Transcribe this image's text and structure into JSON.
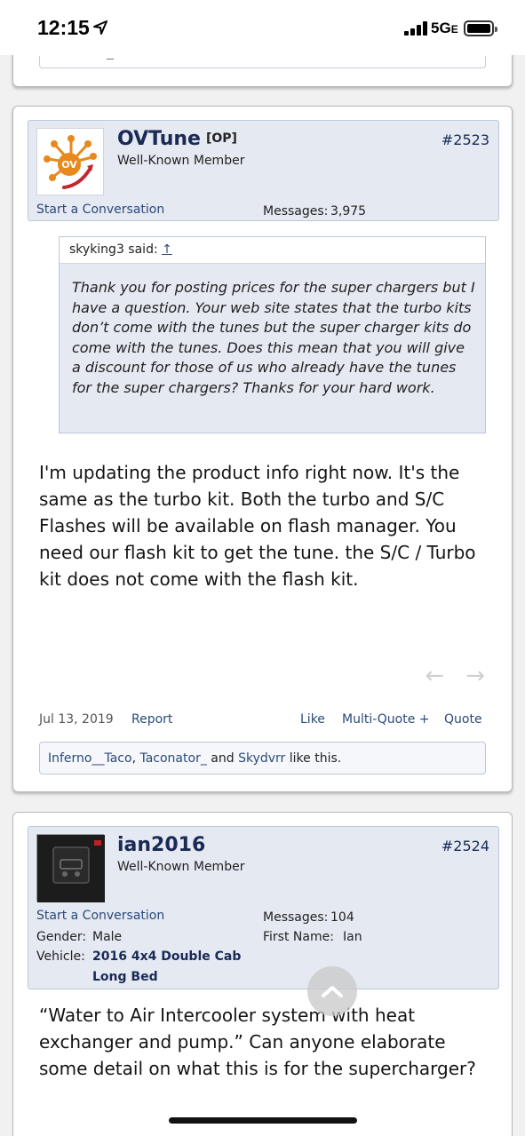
{
  "status_bar": {
    "time": "12:15",
    "network": "5G",
    "network_suffix": "E"
  },
  "posts": [
    {
      "username": "OVTune",
      "badge": "[OP]",
      "user_title": "Well-Known Member",
      "post_number": "#2523",
      "start_conversation": "Start a Conversation",
      "messages_label": "Messages:",
      "messages_value": "3,975",
      "quote": {
        "author": "skyking3 said:",
        "arrow": "↑",
        "text": "Thank you for posting prices for the super chargers but I have a question. Your web site states that the turbo kits don’t come with the tunes but the super charger kits do come with the tunes. Does this mean that you will give a discount for those of us who already have the tunes for the super chargers? Thanks for your hard work."
      },
      "message": "I'm updating the product info right now. It's the same as the turbo kit. Both the turbo and S/C Flashes will be available on flash manager. You need our flash kit to get the tune. the S/C / Turbo kit does not come with the flash kit.",
      "date": "Jul 13, 2019",
      "report": "Report",
      "like": "Like",
      "multi_quote": "Multi-Quote +",
      "quote_label": "Quote",
      "likes": {
        "user1": "Inferno__Taco",
        "sep1": ",",
        "user2": "Taconator_",
        "and": "and",
        "user3": "Skydvrr",
        "suffix": "like this."
      }
    },
    {
      "username": "ian2016",
      "user_title": "Well-Known Member",
      "post_number": "#2524",
      "start_conversation": "Start a Conversation",
      "messages_label": "Messages:",
      "messages_value": "104",
      "gender_label": "Gender:",
      "gender_value": "Male",
      "first_name_label": "First Name:",
      "first_name_value": "Ian",
      "vehicle_label": "Vehicle:",
      "vehicle_line1": "2016 4x4 Double Cab",
      "vehicle_line2": "Long Bed",
      "message": "“Water to Air Intercooler system with heat exchanger and pump.” Can anyone elaborate some detail on what this is for the supercharger?"
    }
  ],
  "icons": {
    "location": "location-arrow-icon",
    "prev": "arrow-left-icon",
    "next": "arrow-right-icon",
    "scroll_top": "chevron-up-icon"
  }
}
